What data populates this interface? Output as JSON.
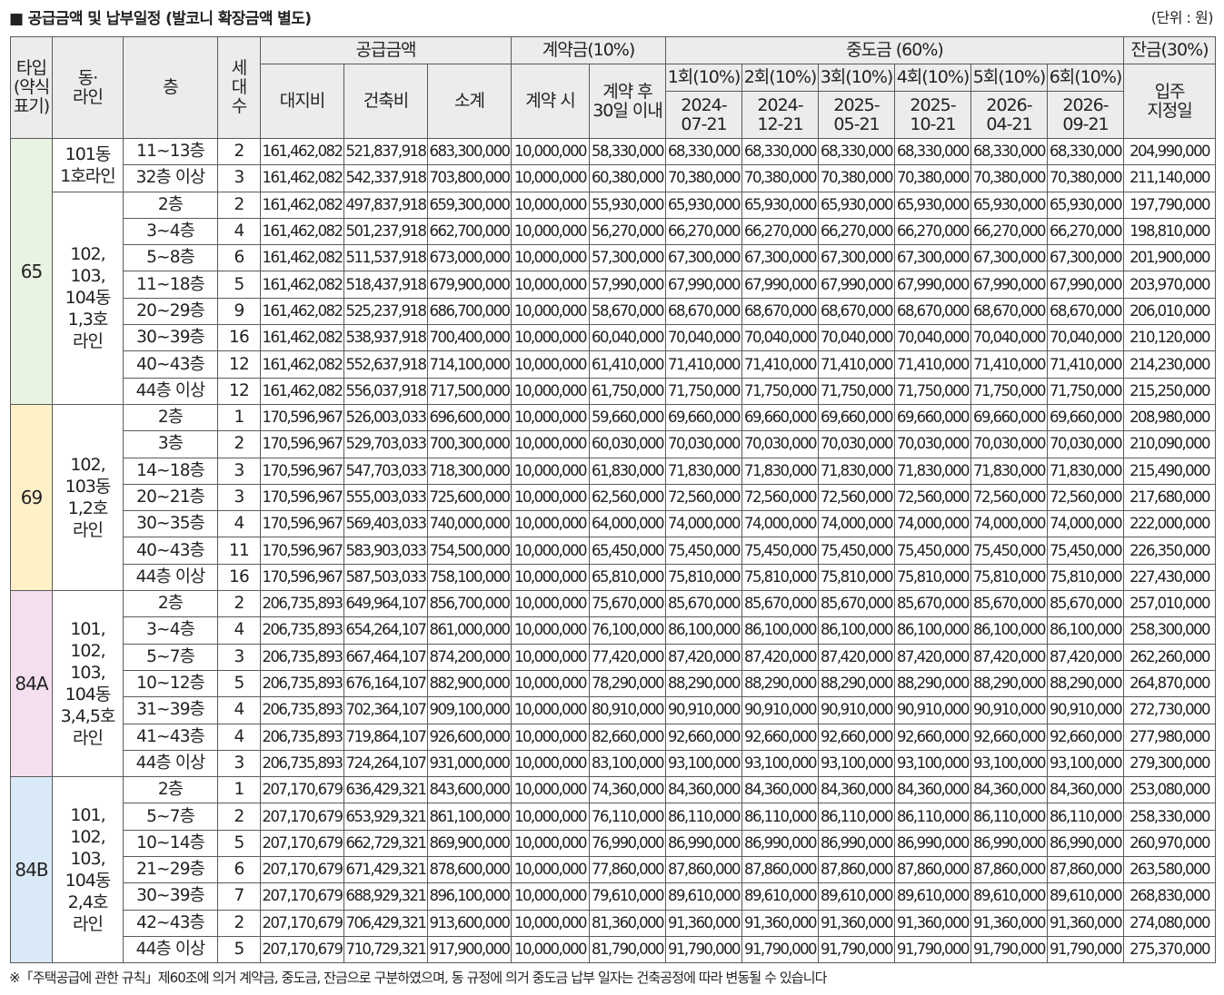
{
  "title": "■ 공급금액 및 납부일정 (발코니 확장금액 별도)",
  "unit": "(단위 : 원)",
  "note": "※「주택공급에 관한 규칙」제60조에 의거 계약금, 중도금, 잔금으로 구분하였으며, 동 규정에 의거 중도금 납부 일자는 건축공정에 따라 변동될 수 있습니다",
  "colors": {
    "header_bg": "#ececec",
    "border": "#5a5a5a",
    "type_65": "#e8f4e1",
    "type_69": "#fff0c8",
    "type_84A": "#f4dff0",
    "type_84B": "#d9e9f7"
  },
  "header": {
    "type": [
      "타입",
      "(약식",
      "표기)"
    ],
    "dong": [
      "동·",
      "라인"
    ],
    "floor": "층",
    "count": [
      "세",
      "대",
      "수"
    ],
    "supply": "공급금액",
    "land": "대지비",
    "building": "건축비",
    "subtotal": "소계",
    "deposit": "계약금(10%)",
    "deposit_at": "계약 시",
    "deposit_after": [
      "계약 후",
      "30일 이내"
    ],
    "middle": "중도금 (60%)",
    "middle_items": [
      {
        "label": "1회(10%)",
        "date": [
          "2024-",
          "07-21"
        ]
      },
      {
        "label": "2회(10%)",
        "date": [
          "2024-",
          "12-21"
        ]
      },
      {
        "label": "3회(10%)",
        "date": [
          "2025-",
          "05-21"
        ]
      },
      {
        "label": "4회(10%)",
        "date": [
          "2025-",
          "10-21"
        ]
      },
      {
        "label": "5회(10%)",
        "date": [
          "2026-",
          "04-21"
        ]
      },
      {
        "label": "6회(10%)",
        "date": [
          "2026-",
          "09-21"
        ]
      }
    ],
    "balance": "잔금(30%)",
    "balance_sub": [
      "입주",
      "지정일"
    ]
  },
  "types": [
    {
      "name": "65",
      "color": "#e8f4e1",
      "groups": [
        {
          "dong": [
            "101동",
            "1호라인"
          ],
          "rows": [
            {
              "floor": "11~13층",
              "count": "2",
              "land": "161,462,082",
              "building": "521,837,918",
              "subtotal": "683,300,000",
              "dep1": "10,000,000",
              "dep2": "58,330,000",
              "middle": "68,330,000",
              "balance": "204,990,000"
            },
            {
              "floor": "32층 이상",
              "count": "3",
              "land": "161,462,082",
              "building": "542,337,918",
              "subtotal": "703,800,000",
              "dep1": "10,000,000",
              "dep2": "60,380,000",
              "middle": "70,380,000",
              "balance": "211,140,000"
            }
          ]
        },
        {
          "dong": [
            "102,",
            "103,",
            "104동",
            "1,3호",
            "라인"
          ],
          "rows": [
            {
              "floor": "2층",
              "count": "2",
              "land": "161,462,082",
              "building": "497,837,918",
              "subtotal": "659,300,000",
              "dep1": "10,000,000",
              "dep2": "55,930,000",
              "middle": "65,930,000",
              "balance": "197,790,000"
            },
            {
              "floor": "3~4층",
              "count": "4",
              "land": "161,462,082",
              "building": "501,237,918",
              "subtotal": "662,700,000",
              "dep1": "10,000,000",
              "dep2": "56,270,000",
              "middle": "66,270,000",
              "balance": "198,810,000"
            },
            {
              "floor": "5~8층",
              "count": "6",
              "land": "161,462,082",
              "building": "511,537,918",
              "subtotal": "673,000,000",
              "dep1": "10,000,000",
              "dep2": "57,300,000",
              "middle": "67,300,000",
              "balance": "201,900,000"
            },
            {
              "floor": "11~18층",
              "count": "5",
              "land": "161,462,082",
              "building": "518,437,918",
              "subtotal": "679,900,000",
              "dep1": "10,000,000",
              "dep2": "57,990,000",
              "middle": "67,990,000",
              "balance": "203,970,000"
            },
            {
              "floor": "20~29층",
              "count": "9",
              "land": "161,462,082",
              "building": "525,237,918",
              "subtotal": "686,700,000",
              "dep1": "10,000,000",
              "dep2": "58,670,000",
              "middle": "68,670,000",
              "balance": "206,010,000"
            },
            {
              "floor": "30~39층",
              "count": "16",
              "land": "161,462,082",
              "building": "538,937,918",
              "subtotal": "700,400,000",
              "dep1": "10,000,000",
              "dep2": "60,040,000",
              "middle": "70,040,000",
              "balance": "210,120,000"
            },
            {
              "floor": "40~43층",
              "count": "12",
              "land": "161,462,082",
              "building": "552,637,918",
              "subtotal": "714,100,000",
              "dep1": "10,000,000",
              "dep2": "61,410,000",
              "middle": "71,410,000",
              "balance": "214,230,000"
            },
            {
              "floor": "44층 이상",
              "count": "12",
              "land": "161,462,082",
              "building": "556,037,918",
              "subtotal": "717,500,000",
              "dep1": "10,000,000",
              "dep2": "61,750,000",
              "middle": "71,750,000",
              "balance": "215,250,000"
            }
          ]
        }
      ]
    },
    {
      "name": "69",
      "color": "#fff0c8",
      "groups": [
        {
          "dong": [
            "102,",
            "103동",
            "1,2호",
            "라인"
          ],
          "rows": [
            {
              "floor": "2층",
              "count": "1",
              "land": "170,596,967",
              "building": "526,003,033",
              "subtotal": "696,600,000",
              "dep1": "10,000,000",
              "dep2": "59,660,000",
              "middle": "69,660,000",
              "balance": "208,980,000"
            },
            {
              "floor": "3층",
              "count": "2",
              "land": "170,596,967",
              "building": "529,703,033",
              "subtotal": "700,300,000",
              "dep1": "10,000,000",
              "dep2": "60,030,000",
              "middle": "70,030,000",
              "balance": "210,090,000"
            },
            {
              "floor": "14~18층",
              "count": "3",
              "land": "170,596,967",
              "building": "547,703,033",
              "subtotal": "718,300,000",
              "dep1": "10,000,000",
              "dep2": "61,830,000",
              "middle": "71,830,000",
              "balance": "215,490,000"
            },
            {
              "floor": "20~21층",
              "count": "3",
              "land": "170,596,967",
              "building": "555,003,033",
              "subtotal": "725,600,000",
              "dep1": "10,000,000",
              "dep2": "62,560,000",
              "middle": "72,560,000",
              "balance": "217,680,000"
            },
            {
              "floor": "30~35층",
              "count": "4",
              "land": "170,596,967",
              "building": "569,403,033",
              "subtotal": "740,000,000",
              "dep1": "10,000,000",
              "dep2": "64,000,000",
              "middle": "74,000,000",
              "balance": "222,000,000"
            },
            {
              "floor": "40~43층",
              "count": "11",
              "land": "170,596,967",
              "building": "583,903,033",
              "subtotal": "754,500,000",
              "dep1": "10,000,000",
              "dep2": "65,450,000",
              "middle": "75,450,000",
              "balance": "226,350,000"
            },
            {
              "floor": "44층 이상",
              "count": "16",
              "land": "170,596,967",
              "building": "587,503,033",
              "subtotal": "758,100,000",
              "dep1": "10,000,000",
              "dep2": "65,810,000",
              "middle": "75,810,000",
              "balance": "227,430,000"
            }
          ]
        }
      ]
    },
    {
      "name": "84A",
      "color": "#f4dff0",
      "groups": [
        {
          "dong": [
            "101,",
            "102,",
            "103,",
            "104동",
            "3,4,5호",
            "라인"
          ],
          "rows": [
            {
              "floor": "2층",
              "count": "2",
              "land": "206,735,893",
              "building": "649,964,107",
              "subtotal": "856,700,000",
              "dep1": "10,000,000",
              "dep2": "75,670,000",
              "middle": "85,670,000",
              "balance": "257,010,000"
            },
            {
              "floor": "3~4층",
              "count": "4",
              "land": "206,735,893",
              "building": "654,264,107",
              "subtotal": "861,000,000",
              "dep1": "10,000,000",
              "dep2": "76,100,000",
              "middle": "86,100,000",
              "balance": "258,300,000"
            },
            {
              "floor": "5~7층",
              "count": "3",
              "land": "206,735,893",
              "building": "667,464,107",
              "subtotal": "874,200,000",
              "dep1": "10,000,000",
              "dep2": "77,420,000",
              "middle": "87,420,000",
              "balance": "262,260,000"
            },
            {
              "floor": "10~12층",
              "count": "5",
              "land": "206,735,893",
              "building": "676,164,107",
              "subtotal": "882,900,000",
              "dep1": "10,000,000",
              "dep2": "78,290,000",
              "middle": "88,290,000",
              "balance": "264,870,000"
            },
            {
              "floor": "31~39층",
              "count": "4",
              "land": "206,735,893",
              "building": "702,364,107",
              "subtotal": "909,100,000",
              "dep1": "10,000,000",
              "dep2": "80,910,000",
              "middle": "90,910,000",
              "balance": "272,730,000"
            },
            {
              "floor": "41~43층",
              "count": "4",
              "land": "206,735,893",
              "building": "719,864,107",
              "subtotal": "926,600,000",
              "dep1": "10,000,000",
              "dep2": "82,660,000",
              "middle": "92,660,000",
              "balance": "277,980,000"
            },
            {
              "floor": "44층 이상",
              "count": "3",
              "land": "206,735,893",
              "building": "724,264,107",
              "subtotal": "931,000,000",
              "dep1": "10,000,000",
              "dep2": "83,100,000",
              "middle": "93,100,000",
              "balance": "279,300,000"
            }
          ]
        }
      ]
    },
    {
      "name": "84B",
      "color": "#d9e9f7",
      "groups": [
        {
          "dong": [
            "101,",
            "102,",
            "103,",
            "104동",
            "2,4호",
            "라인"
          ],
          "rows": [
            {
              "floor": "2층",
              "count": "1",
              "land": "207,170,679",
              "building": "636,429,321",
              "subtotal": "843,600,000",
              "dep1": "10,000,000",
              "dep2": "74,360,000",
              "middle": "84,360,000",
              "balance": "253,080,000"
            },
            {
              "floor": "5~7층",
              "count": "2",
              "land": "207,170,679",
              "building": "653,929,321",
              "subtotal": "861,100,000",
              "dep1": "10,000,000",
              "dep2": "76,110,000",
              "middle": "86,110,000",
              "balance": "258,330,000"
            },
            {
              "floor": "10~14층",
              "count": "5",
              "land": "207,170,679",
              "building": "662,729,321",
              "subtotal": "869,900,000",
              "dep1": "10,000,000",
              "dep2": "76,990,000",
              "middle": "86,990,000",
              "balance": "260,970,000"
            },
            {
              "floor": "21~29층",
              "count": "6",
              "land": "207,170,679",
              "building": "671,429,321",
              "subtotal": "878,600,000",
              "dep1": "10,000,000",
              "dep2": "77,860,000",
              "middle": "87,860,000",
              "balance": "263,580,000"
            },
            {
              "floor": "30~39층",
              "count": "7",
              "land": "207,170,679",
              "building": "688,929,321",
              "subtotal": "896,100,000",
              "dep1": "10,000,000",
              "dep2": "79,610,000",
              "middle": "89,610,000",
              "balance": "268,830,000"
            },
            {
              "floor": "42~43층",
              "count": "2",
              "land": "207,170,679",
              "building": "706,429,321",
              "subtotal": "913,600,000",
              "dep1": "10,000,000",
              "dep2": "81,360,000",
              "middle": "91,360,000",
              "balance": "274,080,000"
            },
            {
              "floor": "44층 이상",
              "count": "5",
              "land": "207,170,679",
              "building": "710,729,321",
              "subtotal": "917,900,000",
              "dep1": "10,000,000",
              "dep2": "81,790,000",
              "middle": "91,790,000",
              "balance": "275,370,000"
            }
          ]
        }
      ]
    }
  ]
}
